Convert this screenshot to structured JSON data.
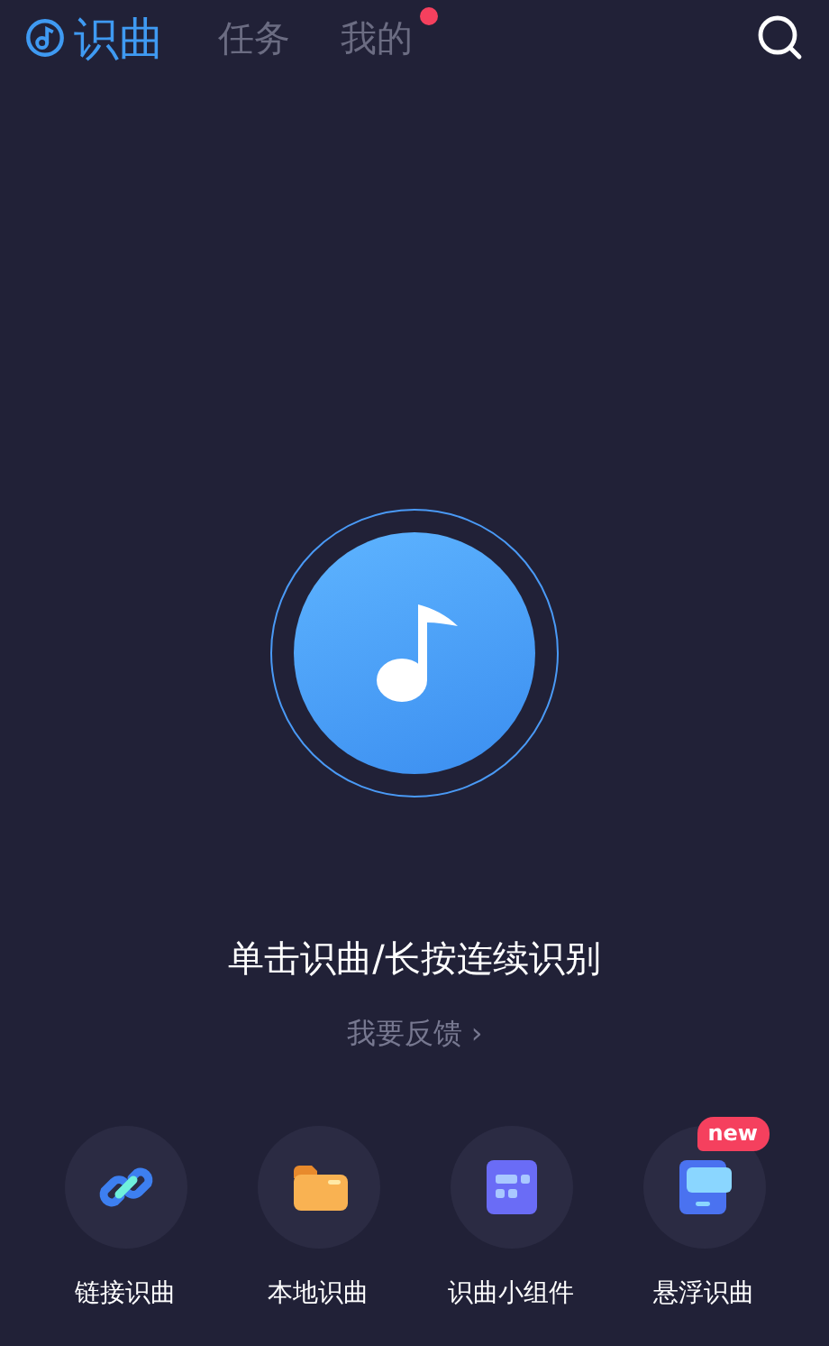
{
  "tabs": [
    {
      "label": "识曲",
      "selected": true,
      "dot": false
    },
    {
      "label": "任务",
      "selected": false,
      "dot": false
    },
    {
      "label": "我的",
      "selected": false,
      "dot": true
    }
  ],
  "hint": "单击识曲/长按连续识别",
  "feedback": "我要反馈 ›",
  "tools": [
    {
      "kind": "link",
      "label": "链接识曲"
    },
    {
      "kind": "folder",
      "label": "本地识曲"
    },
    {
      "kind": "widget",
      "label": "识曲小组件"
    },
    {
      "kind": "float",
      "label": "悬浮识曲",
      "badge": "new"
    }
  ]
}
